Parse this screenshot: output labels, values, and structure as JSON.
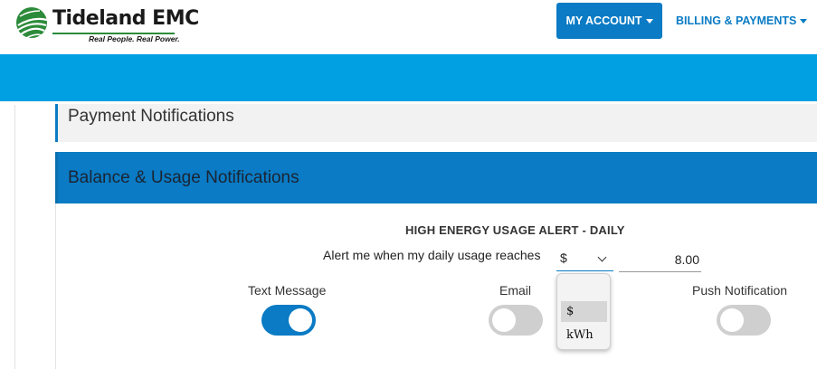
{
  "header": {
    "logo": {
      "name": "Tideland EMC",
      "tagline": "Real People. Real Power."
    },
    "nav": [
      {
        "label": "MY ACCOUNT",
        "active": true
      },
      {
        "label": "BILLING & PAYMENTS",
        "active": false
      }
    ]
  },
  "panels": {
    "payment_notifications": "Payment Notifications",
    "balance_usage_notifications": "Balance & Usage Notifications"
  },
  "alert": {
    "title": "HIGH ENERGY USAGE ALERT - DAILY",
    "label": "Alert me when my daily usage reaches",
    "unit_selected": "$",
    "amount": "8.00",
    "unit_options": [
      "$",
      "kWh"
    ]
  },
  "channels": [
    {
      "label": "Text Message",
      "enabled": true
    },
    {
      "label": "Email",
      "enabled": false
    },
    {
      "label": "Push Notification",
      "enabled": false
    }
  ],
  "colors": {
    "primary": "#0a7bc4",
    "band": "#00a0e3",
    "toggle_off": "#cfcfcf",
    "brand_green": "#2c8b3a"
  }
}
